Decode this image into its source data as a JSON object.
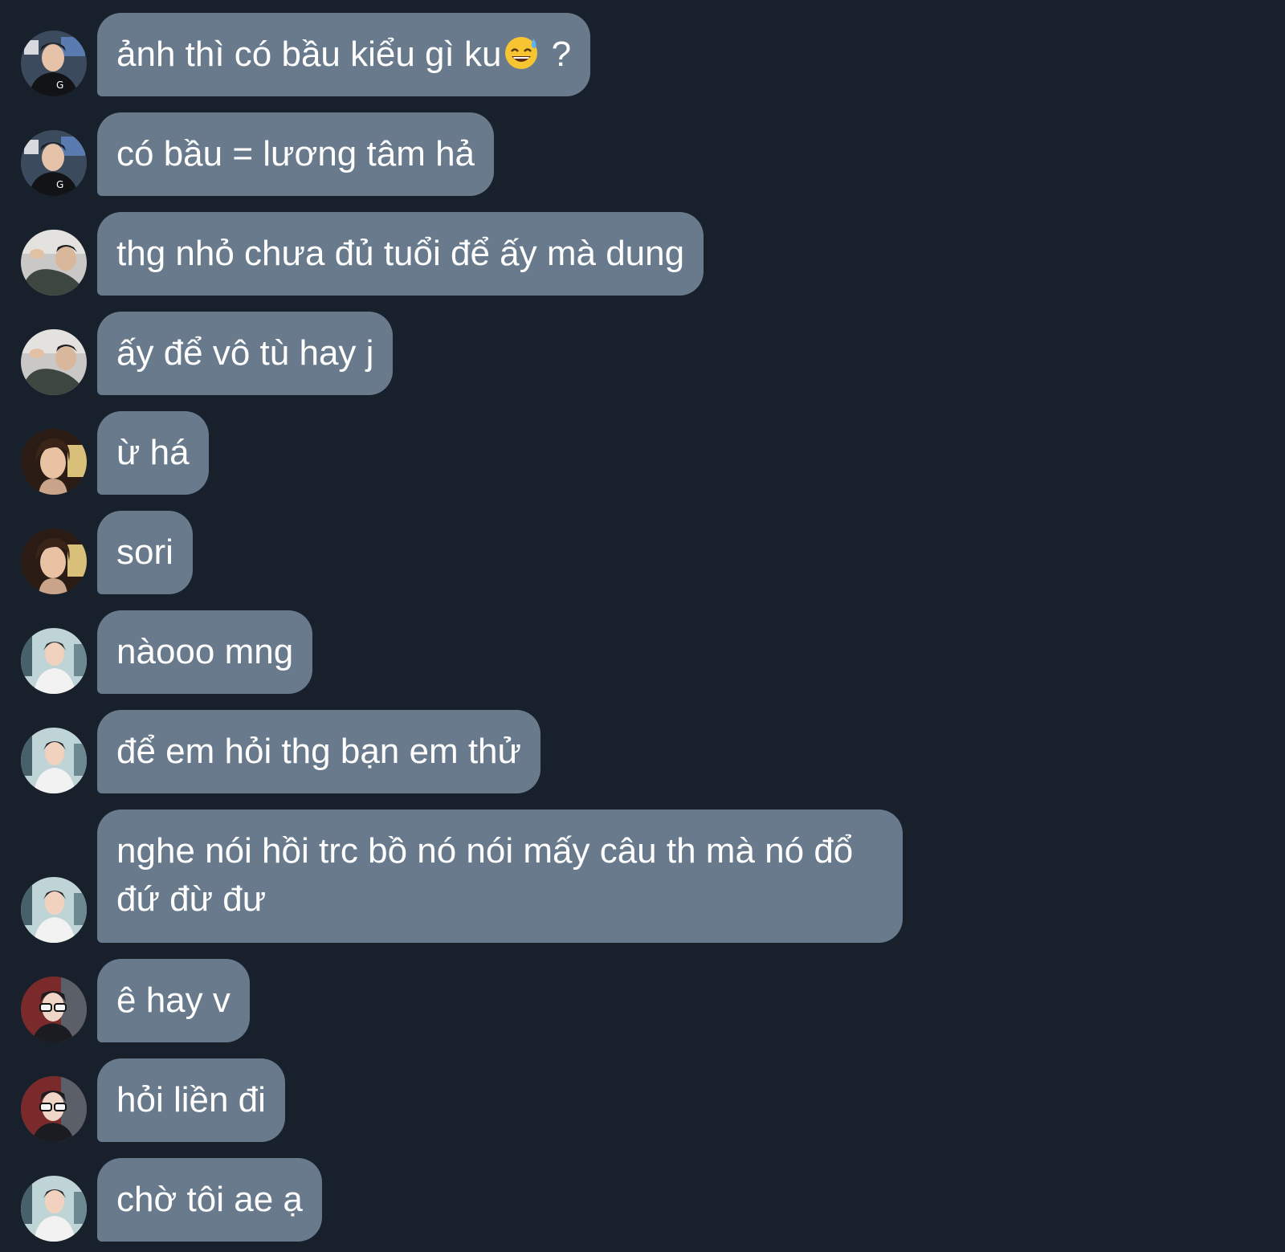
{
  "messages": [
    {
      "text": "ảnh thì có bầu kiểu gì ku",
      "emoji": "sweat-smile-emoji",
      "suffix": " ?",
      "avatar": "avatar-a"
    },
    {
      "text": "có bầu = lương tâm hả",
      "avatar": "avatar-a"
    },
    {
      "text": "thg nhỏ chưa đủ tuổi để ấy mà dung",
      "avatar": "avatar-b"
    },
    {
      "text": "ấy để vô tù hay j",
      "avatar": "avatar-b"
    },
    {
      "text": "ừ há",
      "avatar": "avatar-c"
    },
    {
      "text": "sori",
      "avatar": "avatar-c"
    },
    {
      "text": "nàooo mng",
      "avatar": "avatar-d"
    },
    {
      "text": "để em hỏi thg bạn em thử",
      "avatar": "avatar-d"
    },
    {
      "text": "nghe nói hồi trc bồ nó nói mấy câu th mà nó đổ đứ đừ đư",
      "avatar": "avatar-d"
    },
    {
      "text": "ê hay v",
      "avatar": "avatar-e"
    },
    {
      "text": "hỏi liền đi",
      "avatar": "avatar-e"
    },
    {
      "text": "chờ tôi ae ạ",
      "avatar": "avatar-d"
    }
  ],
  "colors": {
    "background": "#18202b",
    "bubble": "#687a8c",
    "text": "#ffffff"
  }
}
